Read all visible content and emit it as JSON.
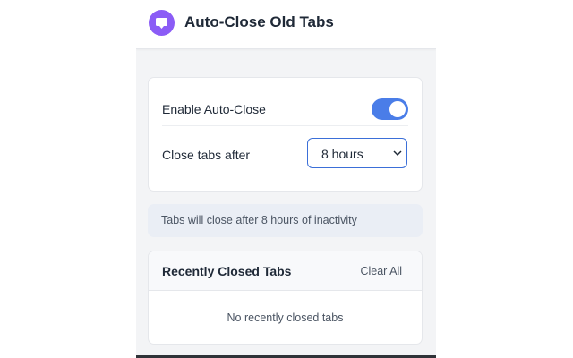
{
  "header": {
    "title": "Auto-Close Old Tabs",
    "logo_icon": "chat-bubble-icon",
    "logo_color": "#8b5cf6"
  },
  "settings": {
    "enable_label": "Enable Auto-Close",
    "enable_state": true,
    "close_after_label": "Close tabs after",
    "close_after_value": "8 hours"
  },
  "info": {
    "text": "Tabs will close after 8 hours of inactivity"
  },
  "recently_closed": {
    "title": "Recently Closed Tabs",
    "clear_label": "Clear All",
    "empty_text": "No recently closed tabs"
  },
  "colors": {
    "accent": "#4a7de8",
    "background": "#f3f4f6"
  }
}
